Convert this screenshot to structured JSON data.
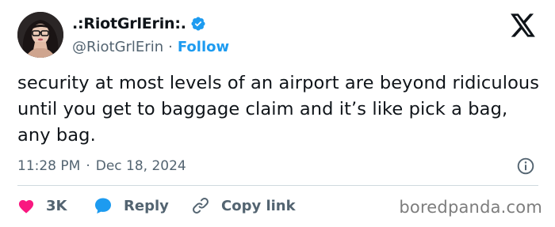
{
  "author": {
    "display_name": ".:RiotGrlErin:.",
    "handle": "@RiotGrlErin",
    "verified": true
  },
  "header": {
    "separator": "·",
    "follow_label": "Follow",
    "logo_icon": "x-logo-icon"
  },
  "tweet": {
    "text": "security at most levels of an airport are beyond ridiculous until you get to baggage claim and it’s like pick a bag, any bag.",
    "time": "11:28 PM",
    "separator": "·",
    "date": "Dec 18, 2024"
  },
  "actions": {
    "like_count": "3K",
    "reply_label": "Reply",
    "copy_link_label": "Copy link"
  },
  "watermark": "boredpanda.com",
  "colors": {
    "accent": "#1d9bf0",
    "like": "#f91880",
    "text": "#0f1419",
    "secondary_text": "#536471",
    "divider": "#cfd9de"
  }
}
